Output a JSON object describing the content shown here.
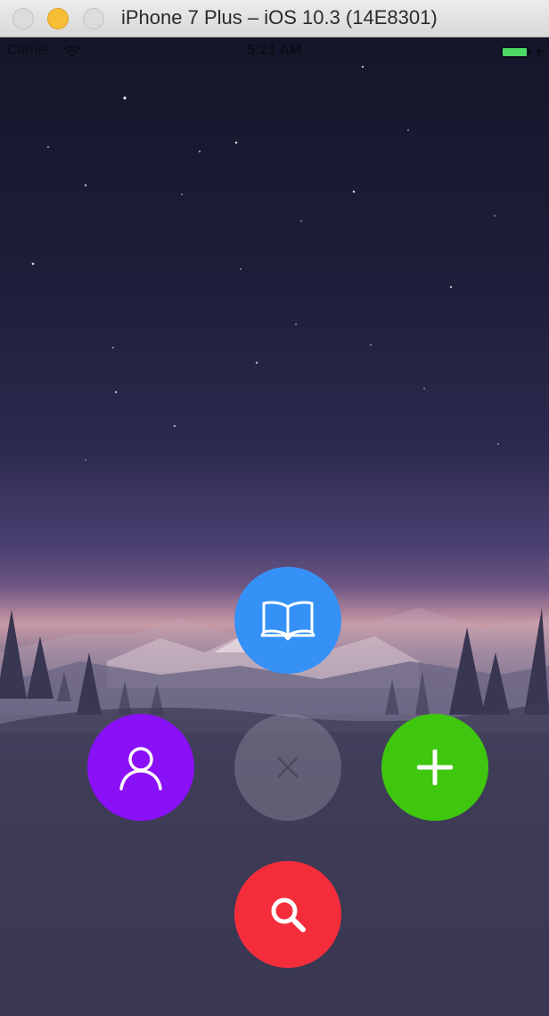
{
  "window": {
    "title": "iPhone 7 Plus – iOS 10.3 (14E8301)"
  },
  "status_bar": {
    "carrier": "Carrier",
    "time": "5:21 AM",
    "battery_color": "#4cd964"
  },
  "fab_menu": {
    "center": {
      "icon": "close-icon",
      "color": "rgba(160,160,175,0.35)"
    },
    "items": [
      {
        "icon": "book-icon",
        "color": "#3691f7"
      },
      {
        "icon": "user-icon",
        "color": "#8a10f7"
      },
      {
        "icon": "plus-icon",
        "color": "#3fc60f"
      },
      {
        "icon": "search-icon",
        "color": "#f42d3b"
      }
    ]
  }
}
